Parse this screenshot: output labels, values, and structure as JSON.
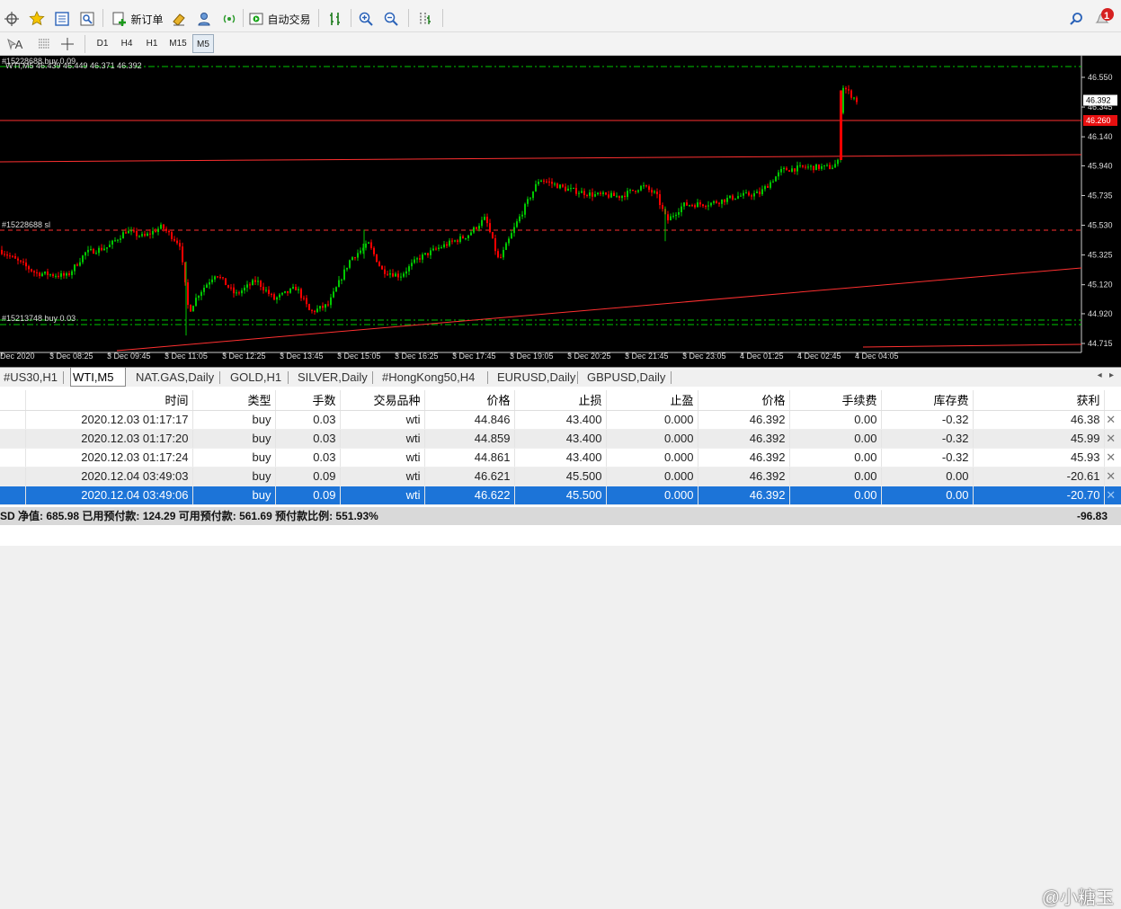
{
  "toolbar": {
    "new_order_label": "新订单",
    "auto_trade_label": "自动交易",
    "notification_count": "1"
  },
  "timeframes": [
    "D1",
    "H4",
    "H1",
    "M15",
    "M5"
  ],
  "active_timeframe": "M5",
  "chart": {
    "header": "WTI,M5  46.439 46.449 46.371 46.392",
    "label_buy_top": "#15228688 buy 0.09",
    "label_sl": "#15228688 sl",
    "label_buy_bottom": "#15213748 buy 0.03",
    "price_labels": [
      "46.550",
      "46.345",
      "46.140",
      "45.940",
      "45.735",
      "45.530",
      "45.325",
      "45.120",
      "44.920",
      "44.715"
    ],
    "current_price": "46.392",
    "red_price": "46.260",
    "time_labels": [
      "Dec 2020",
      "3 Dec 08:25",
      "3 Dec 09:45",
      "3 Dec 11:05",
      "3 Dec 12:25",
      "3 Dec 13:45",
      "3 Dec 15:05",
      "3 Dec 16:25",
      "3 Dec 17:45",
      "3 Dec 19:05",
      "3 Dec 20:25",
      "3 Dec 21:45",
      "3 Dec 23:05",
      "4 Dec 01:25",
      "4 Dec 02:45",
      "4 Dec 04:05"
    ],
    "colors": {
      "bull": "#00c800",
      "bear": "#ff0000",
      "sl_line": "#ff3030",
      "tp_line": "#00c800"
    }
  },
  "chart_tabs": [
    "#US30,H1",
    "WTI,M5",
    "NAT.GAS,Daily",
    "GOLD,H1",
    "SILVER,Daily",
    "#HongKong50,H4",
    "EURUSD,Daily",
    "GBPUSD,Daily"
  ],
  "active_chart_tab": "WTI,M5",
  "orders": {
    "headers": [
      "时间",
      "类型",
      "手数",
      "交易品种",
      "价格",
      "止损",
      "止盈",
      "价格",
      "手续费",
      "库存费",
      "获利"
    ],
    "rows": [
      [
        "2020.12.03 01:17:17",
        "buy",
        "0.03",
        "wti",
        "44.846",
        "43.400",
        "0.000",
        "46.392",
        "0.00",
        "-0.32",
        "46.38"
      ],
      [
        "2020.12.03 01:17:20",
        "buy",
        "0.03",
        "wti",
        "44.859",
        "43.400",
        "0.000",
        "46.392",
        "0.00",
        "-0.32",
        "45.99"
      ],
      [
        "2020.12.03 01:17:24",
        "buy",
        "0.03",
        "wti",
        "44.861",
        "43.400",
        "0.000",
        "46.392",
        "0.00",
        "-0.32",
        "45.93"
      ],
      [
        "2020.12.04 03:49:03",
        "buy",
        "0.09",
        "wti",
        "46.621",
        "45.500",
        "0.000",
        "46.392",
        "0.00",
        "0.00",
        "-20.61"
      ],
      [
        "2020.12.04 03:49:06",
        "buy",
        "0.09",
        "wti",
        "46.622",
        "45.500",
        "0.000",
        "46.392",
        "0.00",
        "0.00",
        "-20.70"
      ]
    ],
    "selected_row": 4
  },
  "status": {
    "text": "SD  净值: 685.98   已用预付款: 124.29   可用预付款: 561.69   预付款比例: 551.93%",
    "total": "-96.83"
  },
  "watermark": "@小糖玉"
}
